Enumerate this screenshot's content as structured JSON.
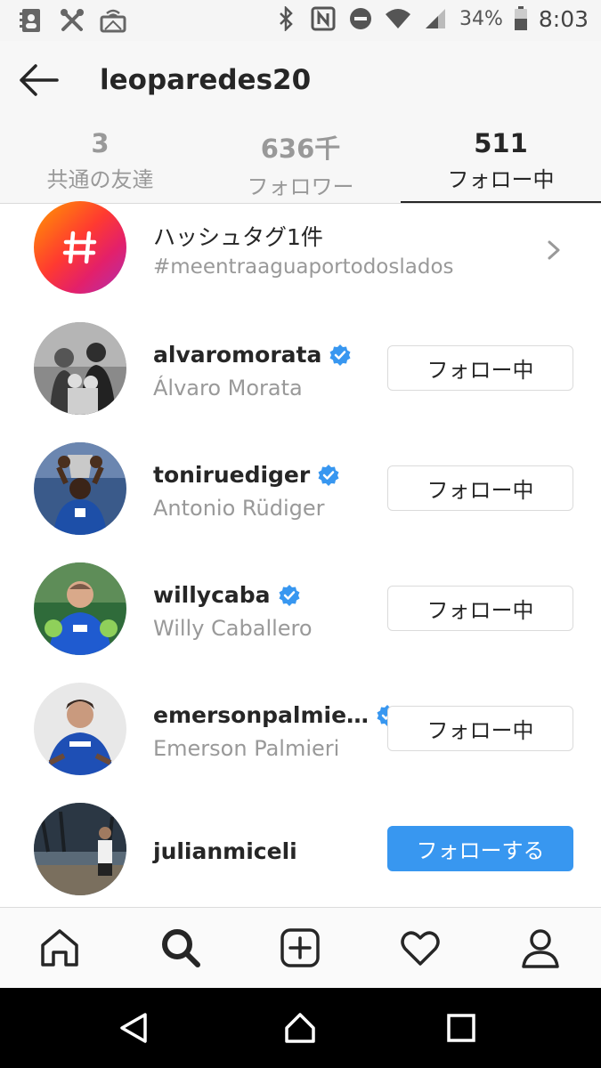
{
  "status_bar": {
    "battery": "34%",
    "time": "8:03",
    "icons_left": [
      "contacts-icon",
      "tools-icon",
      "wireless-display-icon"
    ],
    "icons_right": [
      "bluetooth-icon",
      "nfc-icon",
      "do-not-disturb-icon",
      "wifi-icon",
      "signal-icon",
      "battery-icon"
    ]
  },
  "header": {
    "username": "leoparedes20"
  },
  "tabs": [
    {
      "count": "3",
      "label": "共通の友達",
      "active": false
    },
    {
      "count": "636千",
      "label": "フォロワー",
      "active": false
    },
    {
      "count": "511",
      "label": "フォロー中",
      "active": true
    }
  ],
  "hashtag_row": {
    "title": "ハッシュタグ1件",
    "subtitle": "#meentraaguaportodoslados"
  },
  "accounts": [
    {
      "username": "alvaromorata",
      "name": "Álvaro Morata",
      "verified": true,
      "button": "フォロー中"
    },
    {
      "username": "toniruediger",
      "name": "Antonio Rüdiger",
      "verified": true,
      "button": "フォロー中"
    },
    {
      "username": "willycaba",
      "name": "Willy Caballero",
      "verified": true,
      "button": "フォロー中"
    },
    {
      "username": "emersonpalmie…",
      "name": "Emerson Palmieri",
      "verified": true,
      "button": "フォロー中"
    },
    {
      "username": "julianmiceli",
      "name": "",
      "verified": false,
      "button": "フォローする"
    }
  ],
  "bottom_nav": [
    "home-icon",
    "search-icon",
    "add-post-icon",
    "activity-heart-icon",
    "profile-icon"
  ],
  "system_nav": [
    "back-triangle-icon",
    "home-circle-icon",
    "recents-square-icon"
  ],
  "colors": {
    "accent_blue": "#3897f0",
    "verified_blue": "#3897f0",
    "text_primary": "#262626",
    "text_secondary": "#999999"
  }
}
